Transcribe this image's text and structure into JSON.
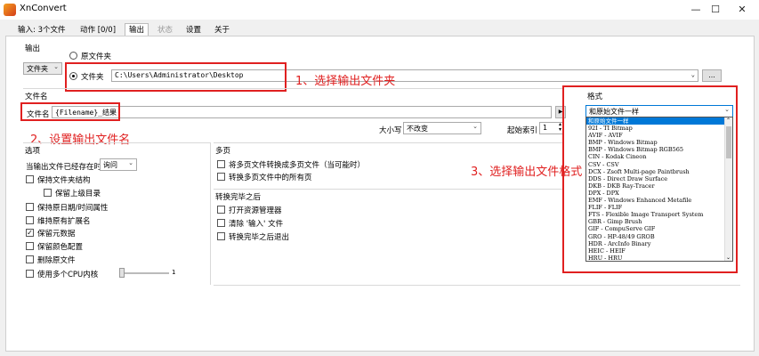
{
  "window": {
    "title": "XnConvert",
    "min": "—",
    "max": "☐",
    "close": "✕"
  },
  "tabs": [
    {
      "label": "输入: 3个文件"
    },
    {
      "label": "动作 [0/0]"
    },
    {
      "label": "输出"
    },
    {
      "label": "状态"
    },
    {
      "label": "设置"
    },
    {
      "label": "关于"
    }
  ],
  "output": {
    "section_label": "输出",
    "type_select": "文件夹",
    "radio_original": "原文件夹",
    "radio_folder": "文件夹",
    "folder_path": "C:\\Users\\Administrator\\Desktop",
    "browse_button": "...",
    "step1": "1、选择输出文件夹"
  },
  "filename": {
    "section_label": "文件名",
    "field_label": "文件名",
    "value": "{Filename}_结果",
    "button": "▶",
    "case_label": "大小写",
    "case_value": "不改变",
    "start_index_label": "起始索引",
    "start_index_value": "1",
    "step2": "2、设置输出文件名"
  },
  "options": {
    "section_label": "选项",
    "exists_label": "当输出文件已经存在时",
    "exists_value": "询问",
    "items": [
      {
        "label": "保持文件夹结构",
        "checked": ""
      },
      {
        "label": "保留上级目录",
        "checked": ""
      },
      {
        "label": "保持原日期/时间属性",
        "checked": ""
      },
      {
        "label": "维持原有扩展名",
        "checked": ""
      },
      {
        "label": "保留元数据",
        "checked": "✓"
      },
      {
        "label": "保留颜色配置",
        "checked": ""
      },
      {
        "label": "删除原文件",
        "checked": ""
      },
      {
        "label": "使用多个CPU内核",
        "checked": ""
      }
    ],
    "cpu_value": "1"
  },
  "multipage": {
    "section_label": "多页",
    "items": [
      {
        "label": "将多页文件转换成多页文件（当可能时）"
      },
      {
        "label": "转换多页文件中的所有页"
      }
    ]
  },
  "after": {
    "section_label": "转换完毕之后",
    "items": [
      {
        "label": "打开资源管理器"
      },
      {
        "label": "清除 '输入' 文件"
      },
      {
        "label": "转换完毕之后退出"
      }
    ]
  },
  "format": {
    "section_label": "格式",
    "selected": "和原始文件一样",
    "step3": "3、选择输出文件格式",
    "options": [
      "和原始文件一样",
      "92I - TI Bitmap",
      "AVIF - AVIF",
      "BMP - Windows Bitmap",
      "BMP - Windows Bitmap RGB565",
      "CIN - Kodak Cineon",
      "CSV - CSV",
      "DCX - Zsoft Multi-page Paintbrush",
      "DDS - Direct Draw Surface",
      "DKB - DKB Ray-Tracer",
      "DPX - DPX",
      "EMF - Windows Enhanced Metafile",
      "FLIF - FLIF",
      "FTS - Flexible Image Transport System",
      "GBR - Gimp Brush",
      "GIF - CompuServe GIF",
      "GRO - HP-48/49 GROB",
      "HDR - ArcInfo Binary",
      "HEIC - HEIF",
      "HRU - HRU"
    ]
  }
}
